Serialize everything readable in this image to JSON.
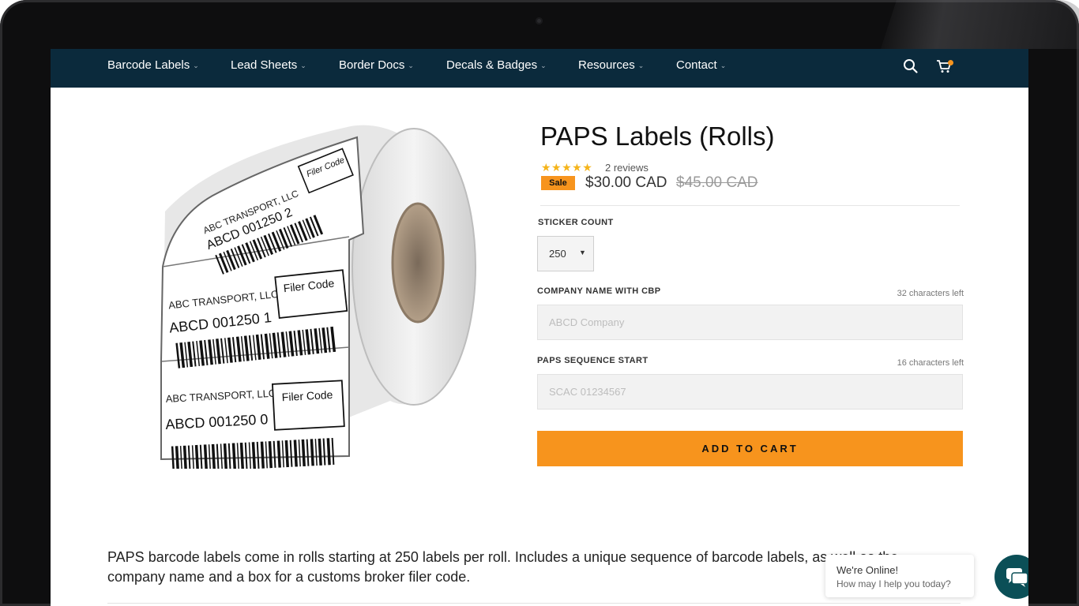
{
  "nav": {
    "items": [
      {
        "label": "Barcode Labels"
      },
      {
        "label": "Lead Sheets"
      },
      {
        "label": "Border Docs"
      },
      {
        "label": "Decals & Badges"
      },
      {
        "label": "Resources"
      },
      {
        "label": "Contact"
      }
    ],
    "chevron": "⌄",
    "icons": [
      "search-icon",
      "cart-icon"
    ]
  },
  "product": {
    "title": "PAPS Labels (Rolls)",
    "rating": 5,
    "stars": "★★★★★",
    "reviews": "2 reviews",
    "sale_badge": "Sale",
    "price": "$30.00 CAD",
    "compare_price": "$45.00 CAD",
    "image": {
      "labels": [
        {
          "company": "ABC TRANSPORT, LLC",
          "code": "ABCD 001250 2",
          "box": "Filer Code"
        },
        {
          "company": "ABC TRANSPORT, LLC",
          "code": "ABCD 001250 1",
          "box": "Filer Code"
        },
        {
          "company": "ABC TRANSPORT, LLC",
          "code": "ABCD 001250 0",
          "box": "Filer Code"
        }
      ]
    }
  },
  "form": {
    "sticker_count": {
      "label": "STICKER COUNT",
      "value": "250"
    },
    "company_name": {
      "label": "COMPANY NAME WITH CBP",
      "chars_left": "32 characters left",
      "placeholder": "ABCD Company"
    },
    "paps_start": {
      "label": "PAPS SEQUENCE START",
      "chars_left": "16 characters left",
      "placeholder": "SCAC 01234567"
    },
    "add_to_cart": "ADD TO CART"
  },
  "description": "PAPS barcode labels come in rolls starting at 250 labels per roll. Includes a unique sequence of barcode labels, as well as the company name and a box for a customs broker filer code.",
  "chat": {
    "title": "We're Online!",
    "subtitle": "How may I help you today?"
  },
  "colors": {
    "nav_bg": "#0b2a3c",
    "accent": "#f7941d",
    "chat_button": "#0b4f57"
  }
}
